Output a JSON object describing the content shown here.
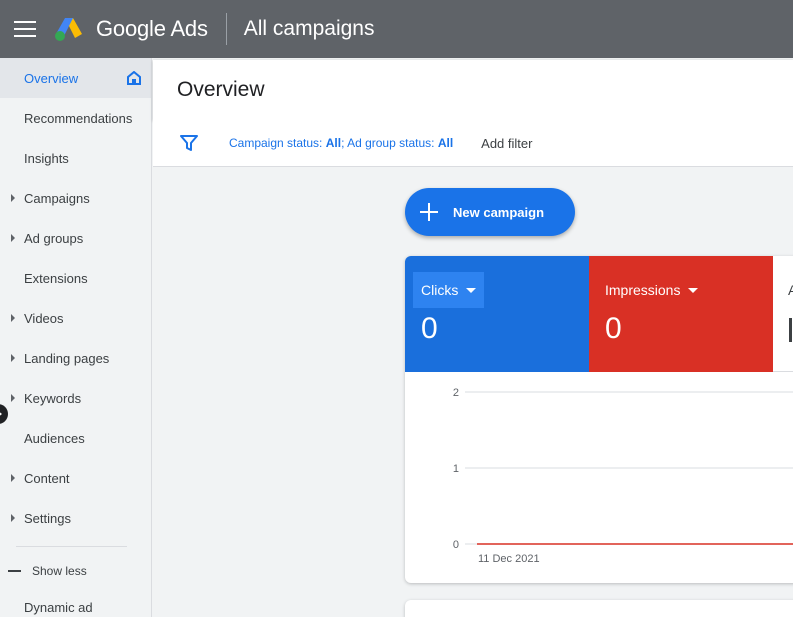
{
  "topbar": {
    "brand": "Google Ads",
    "breadcrumb": "All campaigns",
    "colors": {
      "bar": "#5f6368"
    }
  },
  "sidebar": {
    "items": [
      {
        "label": "Overview",
        "active": true,
        "expandable": false
      },
      {
        "label": "Recommendations",
        "expandable": false
      },
      {
        "label": "Insights",
        "expandable": false
      },
      {
        "label": "Campaigns",
        "expandable": true
      },
      {
        "label": "Ad groups",
        "expandable": true
      },
      {
        "label": "Extensions",
        "expandable": false
      },
      {
        "label": "Videos",
        "expandable": true
      },
      {
        "label": "Landing pages",
        "expandable": true
      },
      {
        "label": "Keywords",
        "expandable": true
      },
      {
        "label": "Audiences",
        "expandable": false
      },
      {
        "label": "Content",
        "expandable": true
      },
      {
        "label": "Settings",
        "expandable": true
      }
    ],
    "show_less": "Show less",
    "extra_item": "Dynamic ad"
  },
  "header": {
    "title": "Overview"
  },
  "filters": {
    "campaign_status_label": "Campaign status: ",
    "campaign_status_value": "All",
    "separator": "; ",
    "ad_group_status_label": "Ad group status: ",
    "ad_group_status_value": "All",
    "add_filter": "Add filter"
  },
  "new_campaign": {
    "label": "New campaign"
  },
  "metrics": {
    "clicks": {
      "label": "Clicks",
      "value": "0",
      "color": "#1a6fdc"
    },
    "impressions": {
      "label": "Impressions",
      "value": "0",
      "color": "#d93025"
    },
    "third": {
      "label_fragment": "A"
    }
  },
  "chart_data": {
    "type": "line",
    "x": [
      "11 Dec 2021"
    ],
    "y_ticks": [
      "2",
      "1",
      "0"
    ],
    "ylim": [
      0,
      2
    ],
    "series": [
      {
        "values": [
          0
        ],
        "color": "#d93025"
      }
    ],
    "grid": true
  }
}
